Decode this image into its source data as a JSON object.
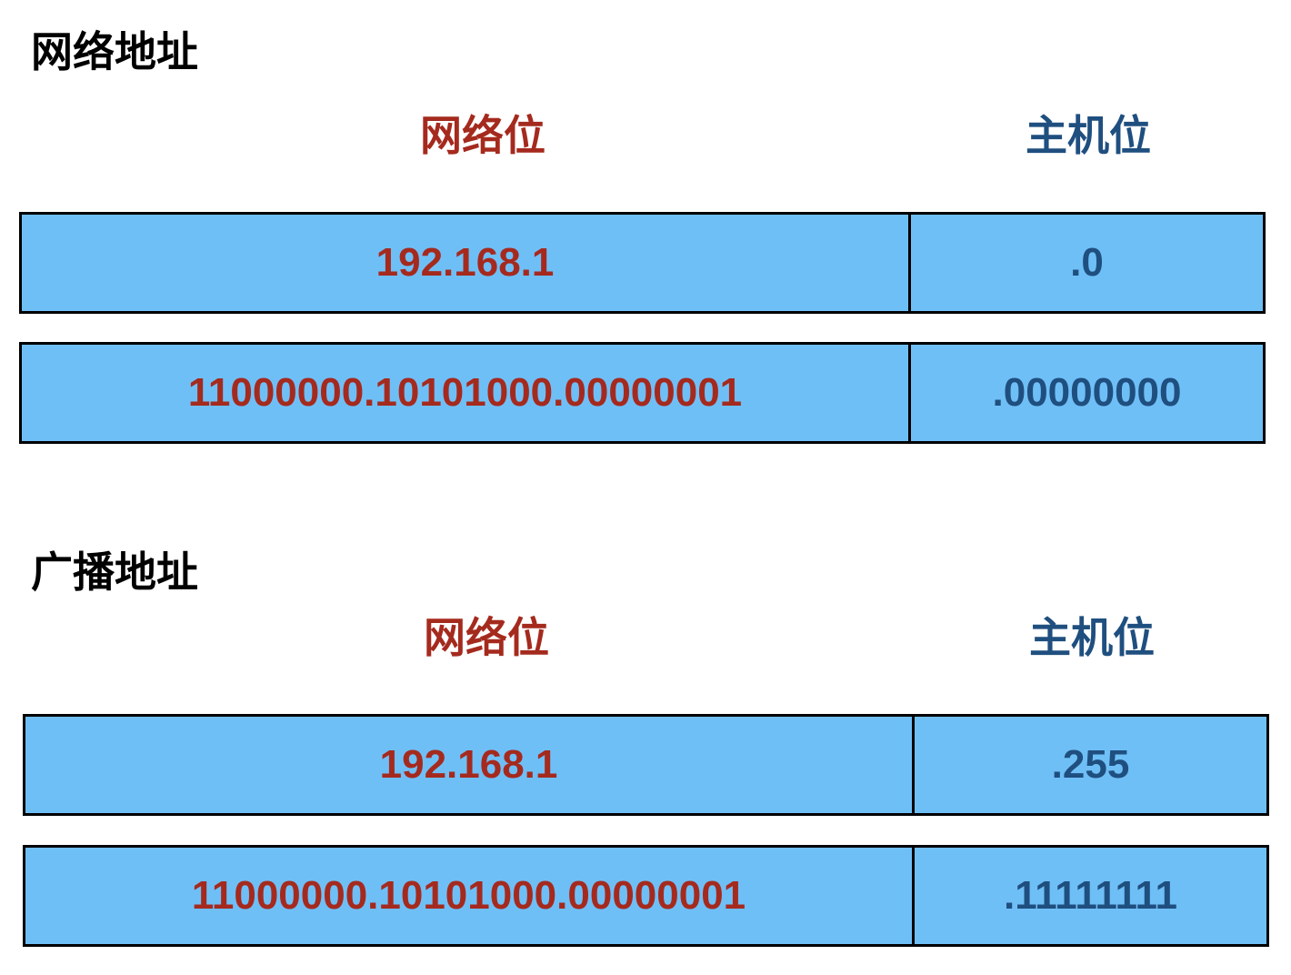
{
  "colors": {
    "network_text": "#a52a1e",
    "host_text": "#1f4f7f",
    "cell_fill": "#6fbff7",
    "border": "#000000"
  },
  "sections": [
    {
      "title": "网络地址",
      "network_header": "网络位",
      "host_header": "主机位",
      "rows": [
        {
          "network": "192.168.1",
          "host": ".0"
        },
        {
          "network": "11000000.10101000.00000001",
          "host": ".00000000"
        }
      ]
    },
    {
      "title": "广播地址",
      "network_header": "网络位",
      "host_header": "主机位",
      "rows": [
        {
          "network": "192.168.1",
          "host": ".255"
        },
        {
          "network": "11000000.10101000.00000001",
          "host": ".11111111"
        }
      ]
    }
  ]
}
